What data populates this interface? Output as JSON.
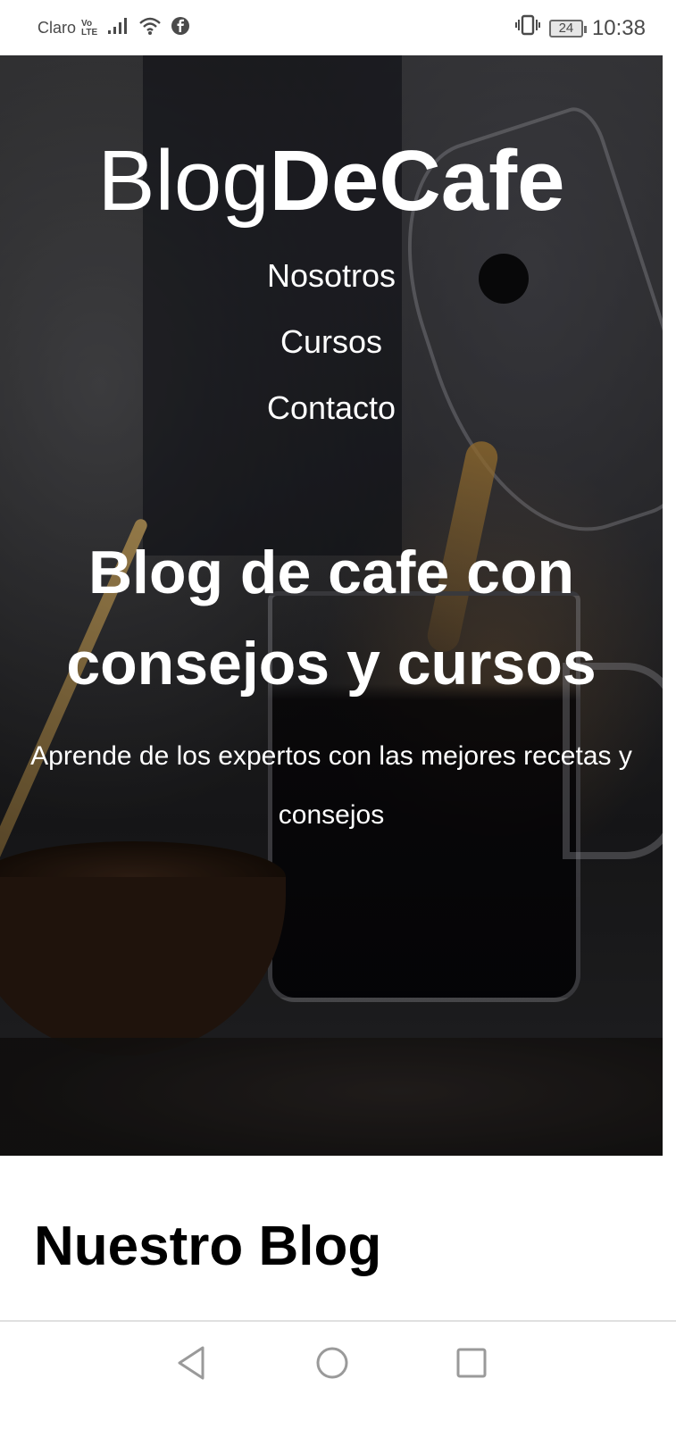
{
  "status_bar": {
    "carrier": "Claro",
    "volte_top": "Vo",
    "volte_bottom": "LTE",
    "battery_level": "24",
    "time": "10:38",
    "icons": [
      "signal-icon",
      "wifi-icon",
      "facebook-icon",
      "vibrate-icon",
      "battery-icon"
    ]
  },
  "header": {
    "title_regular": "Blog",
    "title_bold": "DeCafe"
  },
  "nav": {
    "items": [
      {
        "label": "Nosotros"
      },
      {
        "label": "Cursos"
      },
      {
        "label": "Contacto"
      }
    ]
  },
  "hero": {
    "heading": "Blog de cafe con consejos y cursos",
    "subheading": "Aprende de los expertos con las mejores recetas y consejos"
  },
  "blog": {
    "heading": "Nuestro Blog"
  },
  "system_nav": {
    "buttons": [
      "back-icon",
      "home-icon",
      "recent-apps-icon"
    ]
  }
}
